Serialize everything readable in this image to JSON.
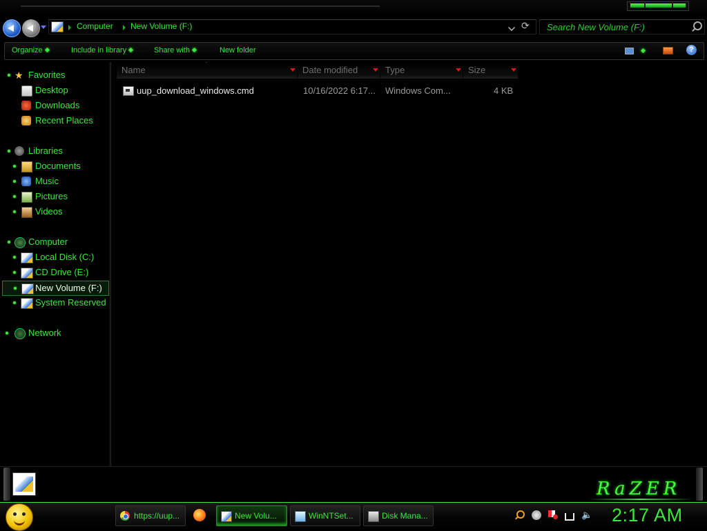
{
  "address": {
    "crumbs": [
      "Computer",
      "New Volume (F:)"
    ]
  },
  "search": {
    "placeholder": "Search New Volume (F:)"
  },
  "toolbar": {
    "organize": "Organize",
    "include_in_library": "Include in library",
    "share_with": "Share with",
    "new_folder": "New folder"
  },
  "nav": {
    "favorites": {
      "label": "Favorites",
      "items": [
        {
          "label": "Desktop",
          "icon": "desktop-icon"
        },
        {
          "label": "Downloads",
          "icon": "downloads-icon"
        },
        {
          "label": "Recent Places",
          "icon": "recent-places-icon"
        }
      ]
    },
    "libraries": {
      "label": "Libraries",
      "items": [
        {
          "label": "Documents",
          "icon": "documents-icon"
        },
        {
          "label": "Music",
          "icon": "music-icon"
        },
        {
          "label": "Pictures",
          "icon": "pictures-icon"
        },
        {
          "label": "Videos",
          "icon": "videos-icon"
        }
      ]
    },
    "computer": {
      "label": "Computer",
      "items": [
        {
          "label": "Local Disk (C:)",
          "icon": "drive-icon"
        },
        {
          "label": "CD Drive (E:)",
          "icon": "drive-icon"
        },
        {
          "label": "New Volume (F:)",
          "icon": "drive-icon",
          "selected": true
        },
        {
          "label": "System Reserved",
          "icon": "drive-icon"
        }
      ]
    },
    "network": {
      "label": "Network"
    }
  },
  "columns": {
    "name": "Name",
    "date_modified": "Date modified",
    "type": "Type",
    "size": "Size"
  },
  "files": [
    {
      "name": "uup_download_windows.cmd",
      "date_modified": "10/16/2022 6:17...",
      "type": "Windows Com...",
      "size": "4 KB"
    }
  ],
  "details": {
    "brand": "RaZER"
  },
  "taskbar": {
    "tasks": [
      {
        "label": "https://uup...",
        "icon": "chrome-icon"
      },
      {
        "label": "New Volu...",
        "icon": "drive-icon",
        "active": true
      },
      {
        "label": "WinNTSet...",
        "icon": "setup-icon"
      },
      {
        "label": "Disk Mana...",
        "icon": "disk-management-icon"
      }
    ],
    "clock": "2:17 AM"
  },
  "colors": {
    "accent": "#3ee63e",
    "background": "#000000",
    "sort_arrow": "#d21b1b"
  }
}
